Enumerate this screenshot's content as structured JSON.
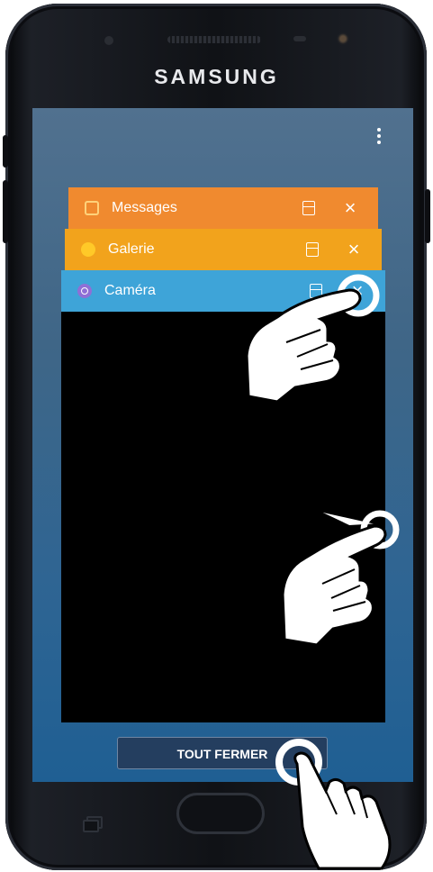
{
  "device": {
    "brand": "SAMSUNG"
  },
  "recent_apps": [
    {
      "label": "Messages",
      "icon": "messages-icon",
      "color": "#f08a2f"
    },
    {
      "label": "Galerie",
      "icon": "gallery-icon",
      "color": "#f2a31c"
    },
    {
      "label": "Caméra",
      "icon": "camera-icon",
      "color": "#3ea4d8"
    }
  ],
  "close_all_label": "TOUT FERMER",
  "colors": {
    "screen_top": "#51718f",
    "screen_bottom": "#1f5f93",
    "close_all_bg": "#243e5f"
  }
}
